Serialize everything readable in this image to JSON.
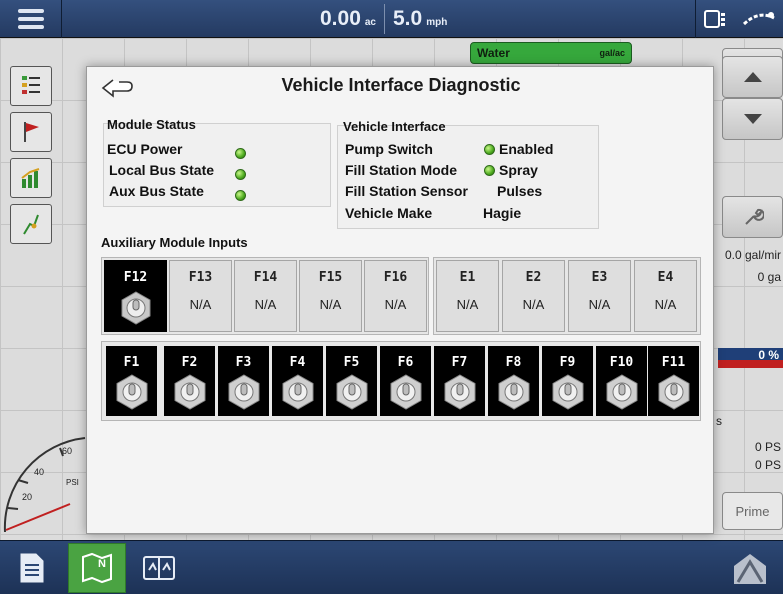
{
  "topbar": {
    "area_value": "0.00",
    "area_unit": "ac",
    "speed_value": "5.0",
    "speed_unit": "mph"
  },
  "product": {
    "name": "Water",
    "rate_unit": "gal/ac",
    "section_count": "1"
  },
  "right_panel": {
    "rate_text": "0.0 gal/mir",
    "volume_text": "0 ga",
    "percent_text": "0 %",
    "suffix_text": "s",
    "pressure_1": "0 PS",
    "pressure_2": "0 PS",
    "prime_label": "Prime"
  },
  "gauge": {
    "unit": "PSI",
    "ticks": [
      "20",
      "40",
      "60"
    ]
  },
  "modal": {
    "title": "Vehicle Interface Diagnostic",
    "module_status": {
      "title": "Module Status",
      "rows": [
        {
          "label": "ECU Power",
          "status": "ok"
        },
        {
          "label": "Local Bus State",
          "status": "ok"
        },
        {
          "label": "Aux Bus State",
          "status": "ok"
        }
      ]
    },
    "vehicle_interface": {
      "title": "Vehicle Interface",
      "rows": [
        {
          "label": "Pump Switch",
          "value": "Enabled",
          "led": true
        },
        {
          "label": "Fill Station Mode",
          "value": "Spray",
          "led": true
        },
        {
          "label": "Fill Station Sensor",
          "value": "Pulses",
          "led": false
        },
        {
          "label": "Vehicle Make",
          "value": "Hagie",
          "led": false
        }
      ]
    },
    "aux_title": "Auxiliary Module Inputs",
    "function_keys": [
      {
        "label": "F12",
        "value": "",
        "active": true
      },
      {
        "label": "F13",
        "value": "N/A",
        "active": false
      },
      {
        "label": "F14",
        "value": "N/A",
        "active": false
      },
      {
        "label": "F15",
        "value": "N/A",
        "active": false
      },
      {
        "label": "F16",
        "value": "N/A",
        "active": false
      }
    ],
    "extra_keys": [
      {
        "label": "E1",
        "value": "N/A"
      },
      {
        "label": "E2",
        "value": "N/A"
      },
      {
        "label": "E3",
        "value": "N/A"
      },
      {
        "label": "E4",
        "value": "N/A"
      }
    ],
    "switch_keys": [
      "F1",
      "F2",
      "F3",
      "F4",
      "F5",
      "F6",
      "F7",
      "F8",
      "F9",
      "F10",
      "F11"
    ]
  },
  "colors": {
    "topbar": "#2c4774",
    "product_green": "#36a83c",
    "led_green": "#4caa1e",
    "progress_red": "#c02020"
  }
}
